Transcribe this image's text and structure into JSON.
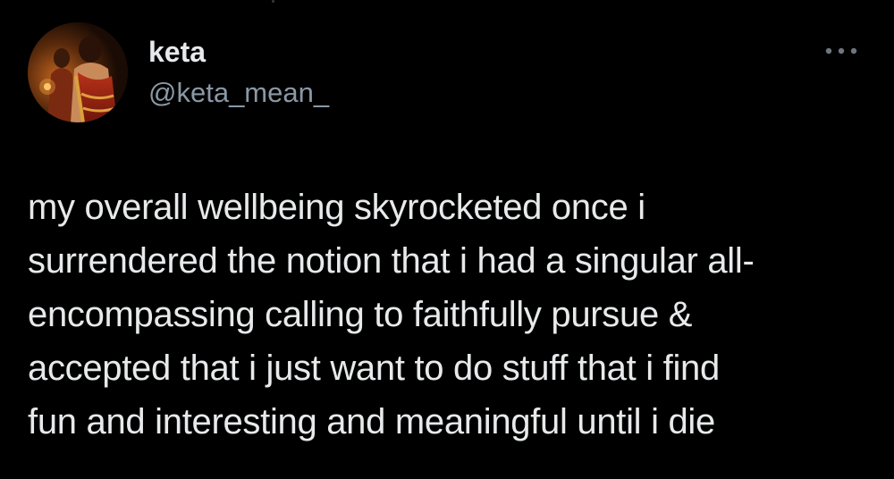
{
  "user": {
    "display_name": "keta",
    "handle": "@keta_mean_",
    "avatar_icon": "avatar-photo"
  },
  "actions": {
    "more_icon": "more-horizontal-icon"
  },
  "tweet": {
    "lines": [
      "my overall wellbeing skyrocketed once i",
      "surrendered the notion that i had a singular all-",
      "encompassing calling to faithfully pursue &",
      "accepted that i just want to do stuff that i find",
      "fun and interesting and meaningful until i die"
    ]
  },
  "colors": {
    "background": "#000000",
    "primary_text": "#e7e9ea",
    "secondary_text": "#8b98a5"
  }
}
